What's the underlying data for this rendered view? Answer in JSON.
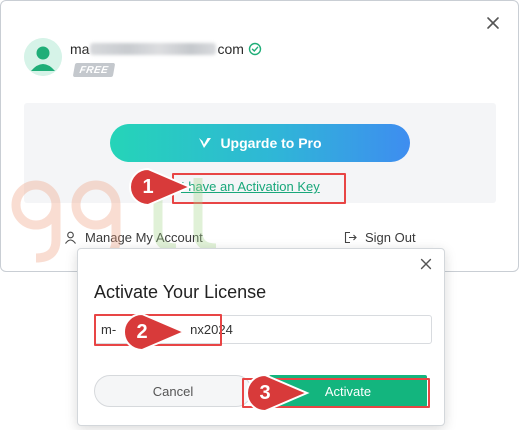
{
  "account": {
    "email_prefix": "ma",
    "email_suffix": "com",
    "plan_badge": "FREE",
    "upgrade_label": "Upgarde to Pro",
    "activation_link": "I have an Activation Key",
    "manage_account": "Manage My Account",
    "sign_out": "Sign Out"
  },
  "dialog": {
    "title": "Activate Your License",
    "license_value_start": "m-",
    "license_value_end": "nx2024",
    "cancel_label": "Cancel",
    "activate_label": "Activate"
  },
  "steps": [
    "1",
    "2",
    "3"
  ],
  "watermark_text": "ggg",
  "colors": {
    "accent_green": "#13b57e",
    "link_green": "#18a77a",
    "highlight_red": "#e84545",
    "marker_red": "#d83a3a"
  },
  "icons": {
    "close": "close-icon",
    "avatar": "user-avatar-icon",
    "verified": "verified-badge-icon",
    "upgrade": "v-logo-icon",
    "manage": "person-icon",
    "signout": "sign-out-icon"
  }
}
